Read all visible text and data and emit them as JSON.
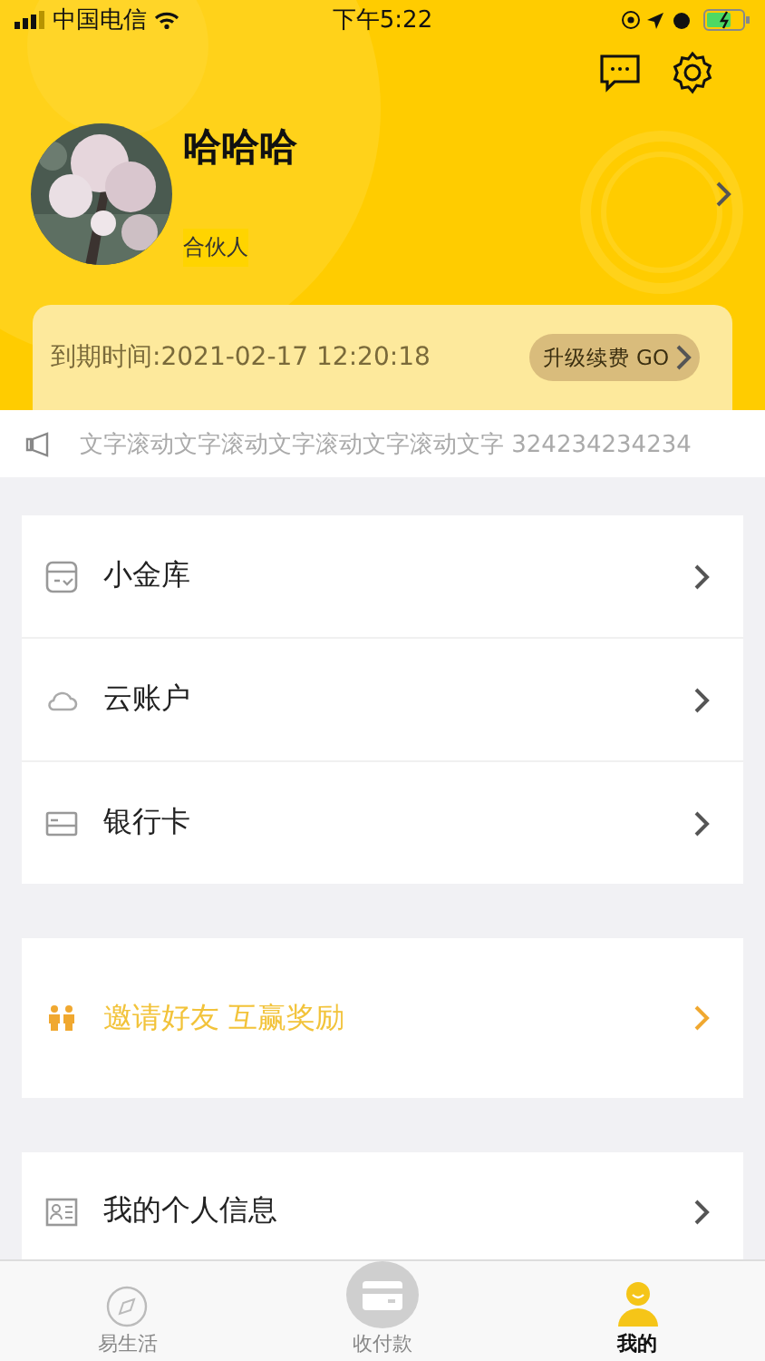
{
  "status_bar": {
    "carrier": "中国电信",
    "time": "下午5:22"
  },
  "profile": {
    "name": "哈哈哈",
    "role": "合伙人"
  },
  "membership": {
    "expiry": "到期时间:2021-02-17 12:20:18",
    "button": "升级续费 GO"
  },
  "notice": {
    "text": "文字滚动文字滚动文字滚动文字滚动文字 324234234234"
  },
  "menu_groups": [
    {
      "items": [
        {
          "kind": "vault",
          "label": "小金库",
          "highlight": false
        },
        {
          "kind": "cloud",
          "label": "云账户",
          "highlight": false
        },
        {
          "kind": "card",
          "label": "银行卡",
          "highlight": false
        }
      ]
    },
    {
      "items": [
        {
          "kind": "invite",
          "label": "邀请好友 互赢奖励",
          "highlight": true
        }
      ]
    },
    {
      "items": [
        {
          "kind": "profile",
          "label": "我的个人信息",
          "highlight": false
        }
      ]
    }
  ],
  "tab_bar": [
    {
      "kind": "compass",
      "label": "易生活",
      "selected": false
    },
    {
      "kind": "pay",
      "label": "收付款",
      "selected": false
    },
    {
      "kind": "person",
      "label": "我的",
      "selected": true
    }
  ]
}
